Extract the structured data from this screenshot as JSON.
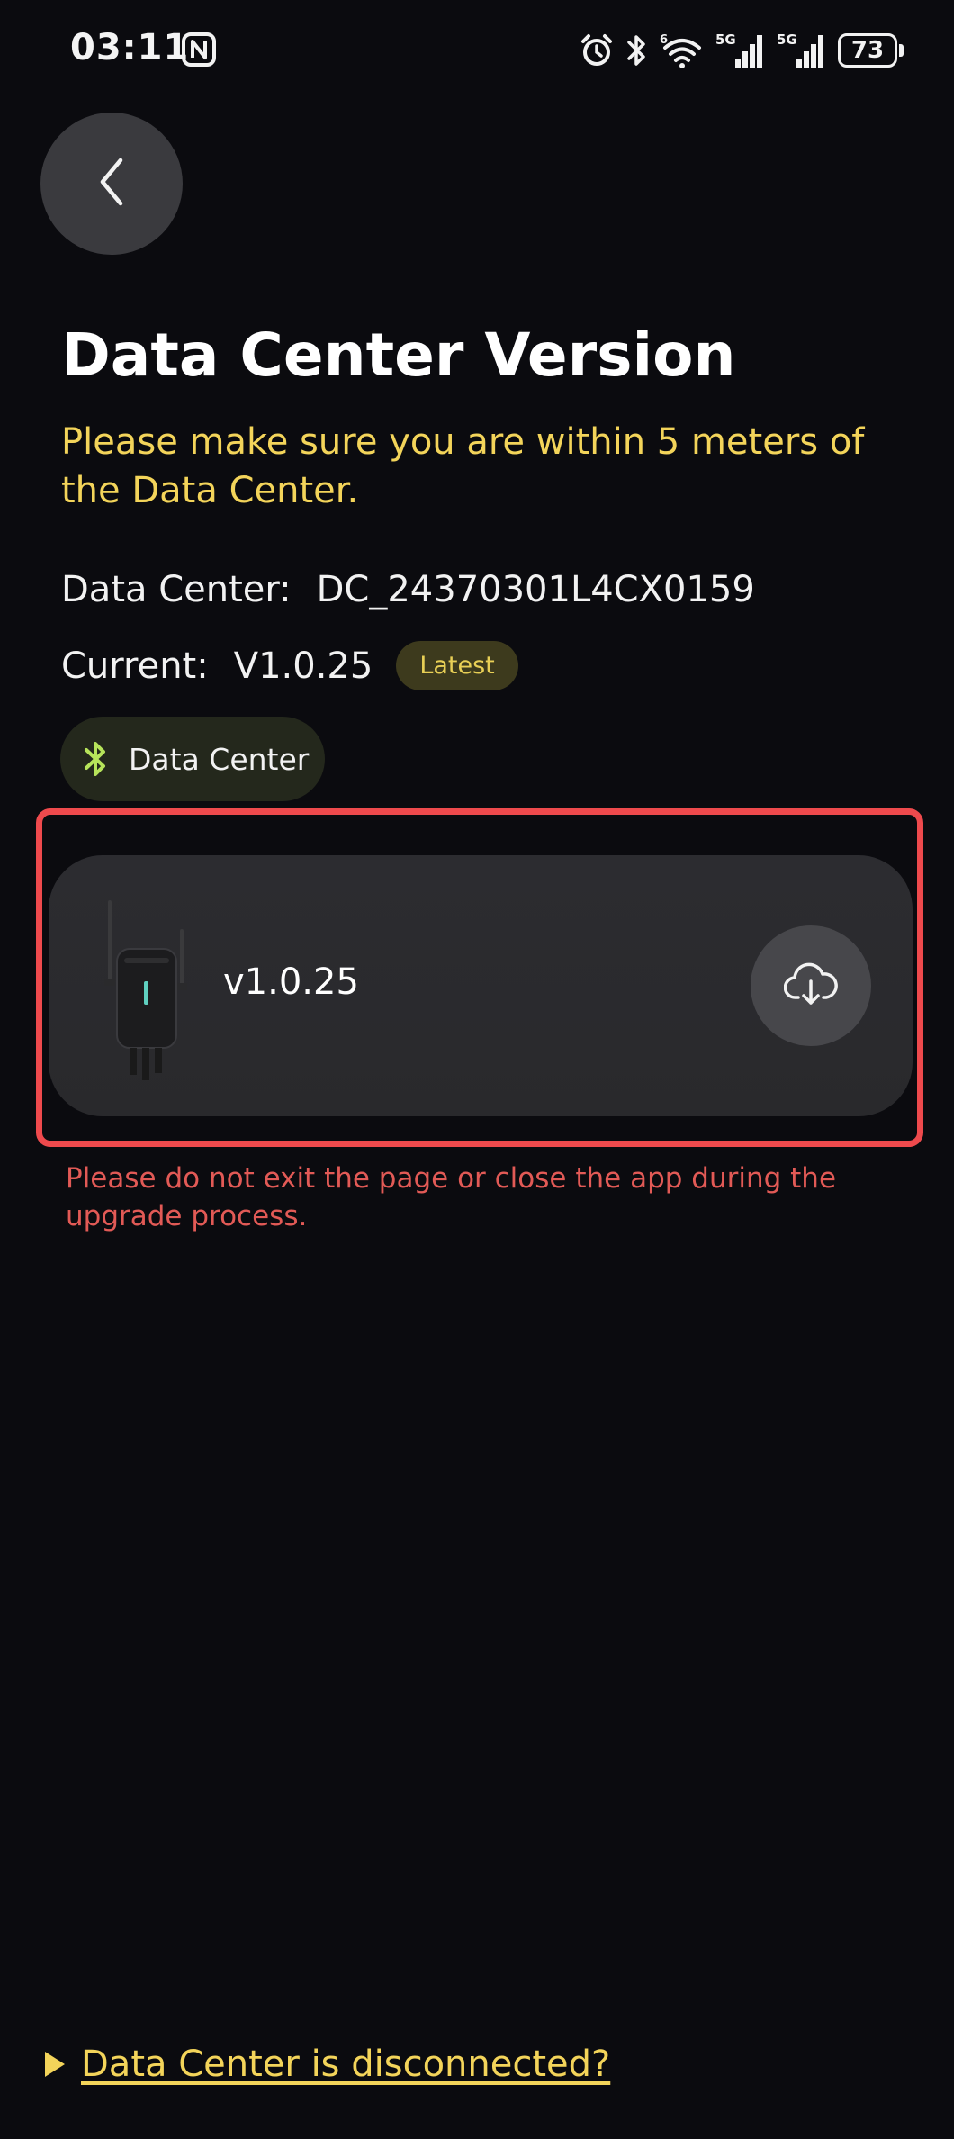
{
  "status_bar": {
    "time": "03:11",
    "signal1_label": "5G",
    "signal2_label": "5G",
    "wifi_label": "6",
    "battery": "73",
    "icons": [
      "nfc-icon",
      "alarm-icon",
      "bluetooth-icon",
      "wifi-icon",
      "signal-icon",
      "signal-icon",
      "battery-icon"
    ]
  },
  "page": {
    "title": "Data Center Version",
    "notice": "Please make sure you are within 5 meters of the Data Center."
  },
  "info": {
    "data_center_label": "Data Center:",
    "data_center_value": "DC_24370301L4CX0159",
    "current_label": "Current:",
    "current_value": "V1.0.25",
    "latest_badge": "Latest"
  },
  "connection_chip": {
    "icon": "bluetooth-icon",
    "label": "Data Center"
  },
  "device_card": {
    "version": "v1.0.25",
    "action_icon": "cloud-download-icon"
  },
  "upgrade_warning": "Please do not exit the page or close the app during the upgrade process.",
  "footer": {
    "disconnected_link": "Data Center is disconnected?"
  },
  "colors": {
    "background": "#0b0b0f",
    "accent_yellow": "#f3d45a",
    "warning_red": "#e25a56",
    "highlight_frame": "#ef4a4d",
    "bluetooth_green": "#b6e35a"
  }
}
